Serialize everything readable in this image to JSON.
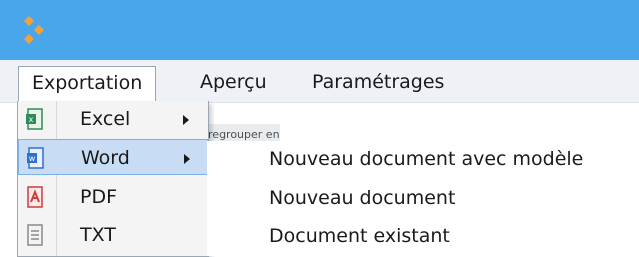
{
  "colors": {
    "titlebar": "#4aa6ea",
    "logo": "#f2a23a",
    "highlight": "#c8ddf3",
    "excel_icon": "#2e8b57",
    "word_icon": "#2f6fd0",
    "pdf_icon": "#d23b3b",
    "txt_icon": "#8a8a8a"
  },
  "menubar": {
    "items": [
      "Exportation",
      "Aperçu",
      "Paramétrages"
    ]
  },
  "group_hint": "r regrouper en fonction de celle-ci",
  "export_menu": {
    "items": [
      {
        "label": "Excel",
        "icon": "excel-icon",
        "has_submenu": true
      },
      {
        "label": "Word",
        "icon": "word-icon",
        "has_submenu": true,
        "highlighted": true
      },
      {
        "label": "PDF",
        "icon": "pdf-icon",
        "has_submenu": false
      },
      {
        "label": "TXT",
        "icon": "txt-icon",
        "has_submenu": false
      }
    ]
  },
  "word_submenu": {
    "items": [
      "Nouveau document avec modèle",
      "Nouveau document",
      "Document existant"
    ]
  }
}
